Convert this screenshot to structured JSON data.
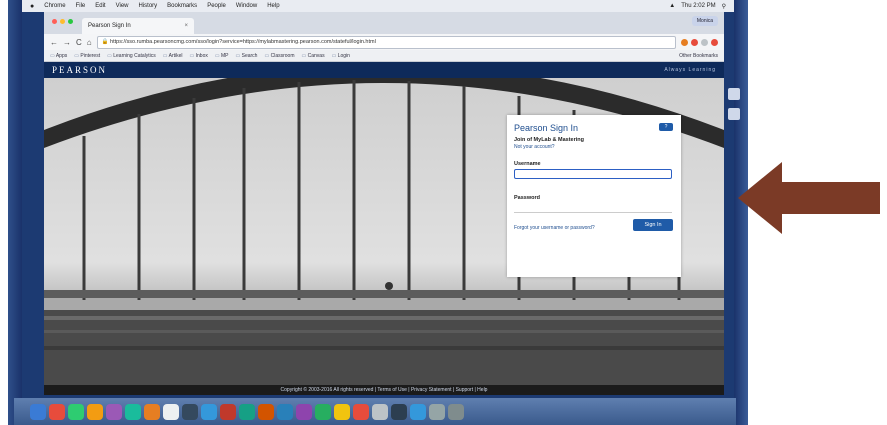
{
  "mac_menubar": {
    "apple": "",
    "items": [
      "Chrome",
      "File",
      "Edit",
      "View",
      "History",
      "Bookmarks",
      "People",
      "Window",
      "Help"
    ],
    "status": "Thu 2:02 PM"
  },
  "browser": {
    "tab_title": "Pearson Sign In",
    "tab_close": "×",
    "profile": "Monica",
    "back": "←",
    "forward": "→",
    "reload": "C",
    "home": "⌂",
    "url": "https://sso.rumba.pearsoncmg.com/sso/login?service=https://mylabmastering.pearson.com/stateful/login.html",
    "bookmarks": [
      "Apps",
      "Pinterest",
      "Learning Catalytics",
      "Artikel",
      "Inbox",
      "MP",
      "Search",
      "Classroom",
      "Canvas",
      "Login"
    ],
    "other_bookmarks": "Other Bookmarks"
  },
  "site_header": {
    "logo": "PEARSON",
    "link": "Always Learning"
  },
  "login": {
    "title": "Pearson Sign In",
    "help_icon": "?",
    "subtitle": "Join of MyLab & Mastering",
    "subtitle_link": "Not your account?",
    "username_label": "Username",
    "username_value": "",
    "password_label": "Password",
    "password_value": "",
    "forgot": "Forgot your username or password?",
    "signin": "Sign In"
  },
  "footer": {
    "text": "Copyright © 2003-2016 All rights reserved | Terms of Use | Privacy Statement | Support | Help"
  },
  "colors": {
    "accent": "#1f5ba8",
    "header": "#0e2a5a",
    "arrow": "#7b3a26"
  }
}
